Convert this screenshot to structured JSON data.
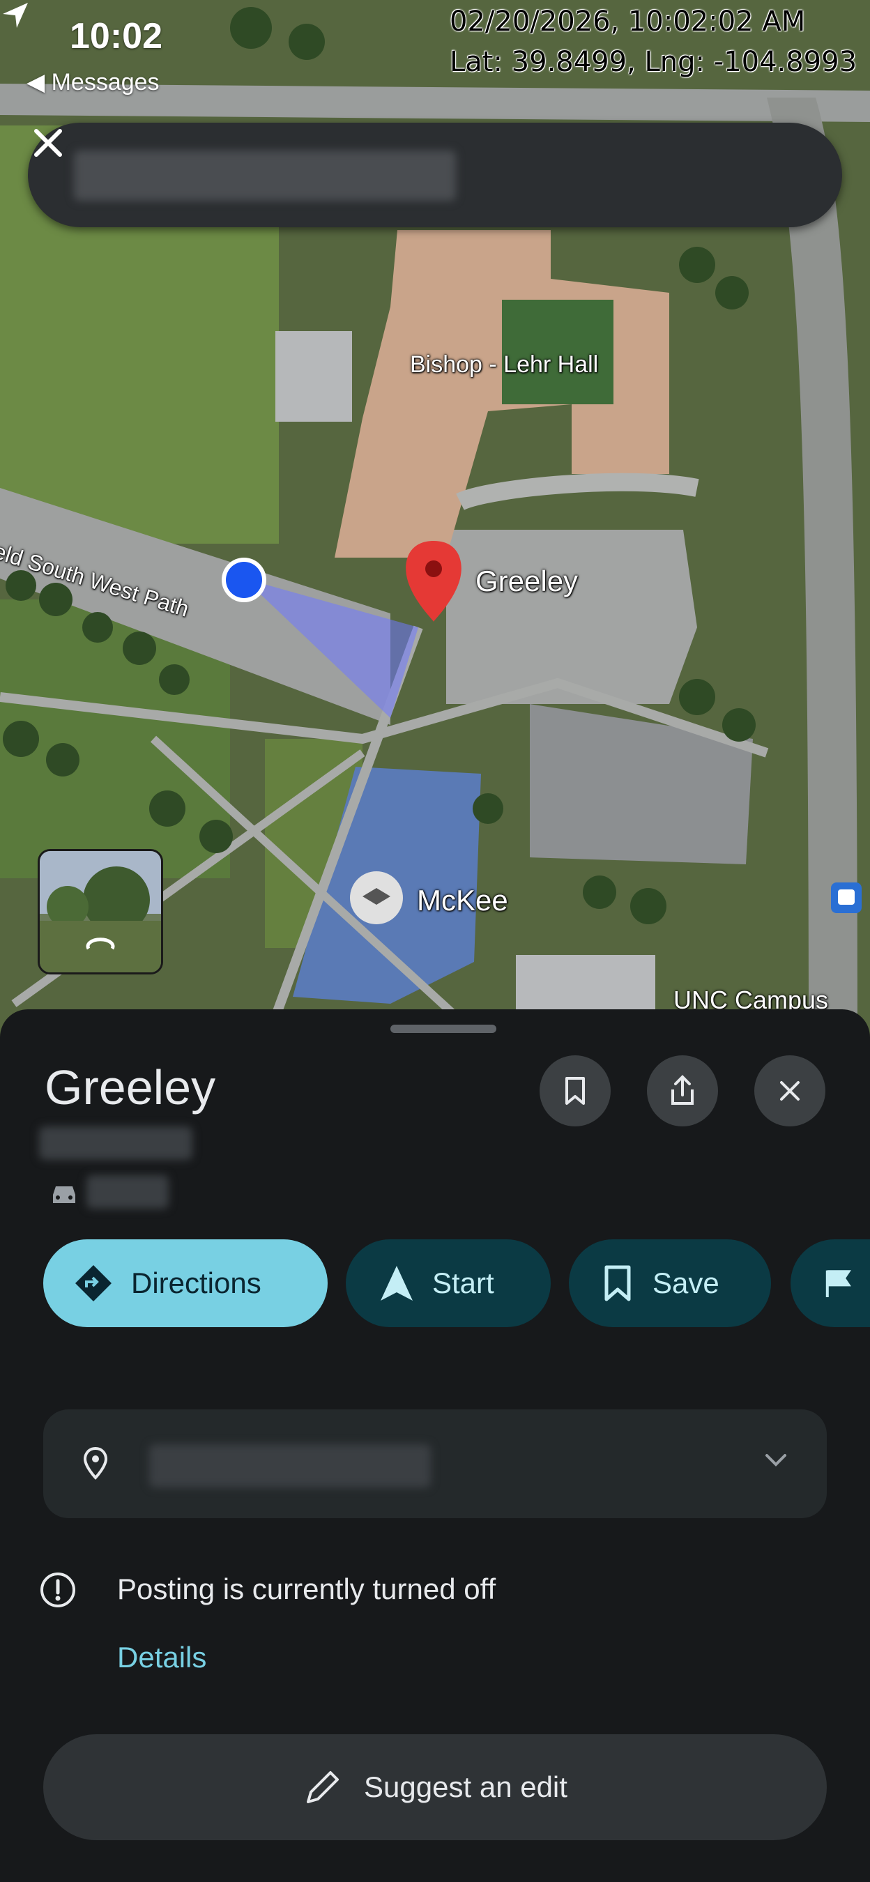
{
  "status_bar": {
    "time": "10:02",
    "back_label": "◀ Messages"
  },
  "overlay": {
    "timestamp": "02/20/2026, 10:02:02 AM",
    "coordinates": "Lat: 39.8499, Lng: -104.8993"
  },
  "search": {
    "close_icon": "close-icon"
  },
  "map": {
    "labels": {
      "hall": "Bishop - Lehr Hall",
      "pin": "Greeley",
      "path": "ield South West Path",
      "building": "McKee",
      "campus": "UNC Campus"
    },
    "colors": {
      "grass": "#5d6b48",
      "roof": "#c9a48a",
      "pin": "#e53935",
      "location_dot": "#1a56f0",
      "roof_blue": "#5a7ab5"
    }
  },
  "sheet": {
    "title": "Greeley",
    "actions": {
      "directions": "Directions",
      "start": "Start",
      "save": "Save"
    },
    "info": {
      "posting_status": "Posting is currently turned off",
      "details_link": "Details"
    },
    "suggest_edit": "Suggest an edit",
    "colors": {
      "accent": "#78d0e3",
      "chip_dark": "#0b3a44",
      "background": "#17191b"
    }
  }
}
